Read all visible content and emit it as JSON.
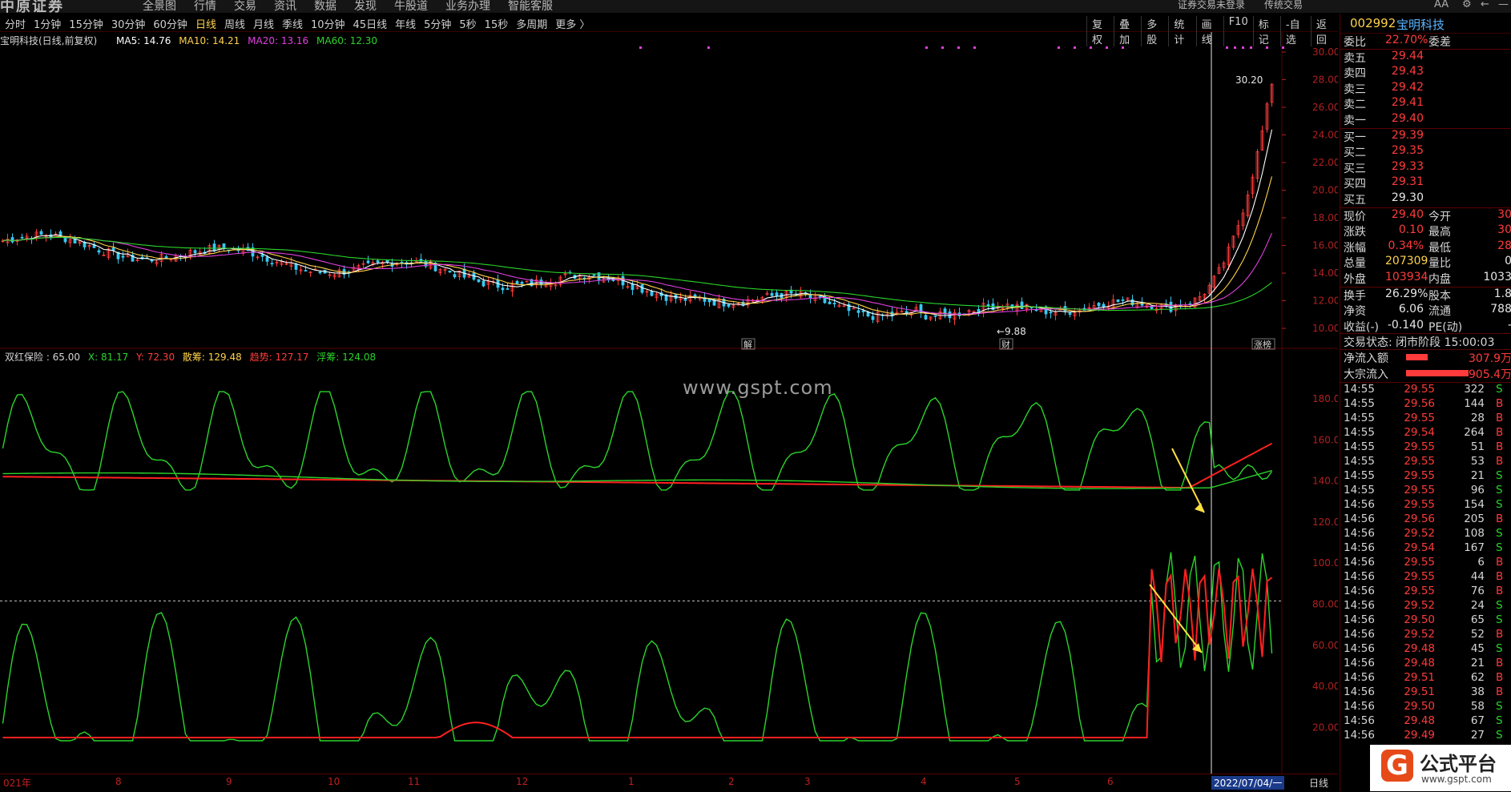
{
  "app": {
    "logo": "中原证券",
    "menu": [
      "全景图",
      "行情",
      "交易",
      "资讯",
      "数据",
      "发现",
      "牛股道",
      "业务办理",
      "智能客服"
    ],
    "right_menu": [
      "证券交易未登录",
      "传统交易"
    ],
    "font_btn": "AA"
  },
  "period_bar": {
    "items": [
      "分时",
      "1分钟",
      "15分钟",
      "30分钟",
      "60分钟",
      "日线",
      "周线",
      "月线",
      "季线",
      "10分钟",
      "45日线",
      "年线",
      "5分钟",
      "5秒",
      "15秒",
      "多周期",
      "更多 〉"
    ],
    "active": "日线",
    "tools": [
      "复权",
      "叠加",
      "多股",
      "统计",
      "画线",
      "F10",
      "标记",
      "-自选",
      "返回"
    ]
  },
  "chart_header": {
    "title": "宝明科技(日线,前复权)",
    "ma5": "MA5: 14.76",
    "ma10": "MA10: 14.21",
    "ma20": "MA20: 13.16",
    "ma60": "MA60: 12.30"
  },
  "price_axis": [
    "30.00",
    "28.00",
    "26.00",
    "24.00",
    "22.00",
    "20.00",
    "18.00",
    "16.00",
    "14.00",
    "12.00",
    "10.00"
  ],
  "price_annotations": {
    "high": "30.20",
    "low": "9.88",
    "mark1": "解",
    "mark2": "财",
    "mark3": "涨榜"
  },
  "indicator_header": {
    "name": "双红保险 : 65.00",
    "x": "X: 81.17",
    "y": "Y: 72.30",
    "sanchou": "散筹: 129.48",
    "qushi": "趋势: 127.17",
    "fuchou": "浮筹: 124.08"
  },
  "indicator_axis": [
    "180.00",
    "160.00",
    "140.00",
    "120.00",
    "100.00",
    "80.00",
    "60.00",
    "40.00",
    "20.00"
  ],
  "watermark_site": "www.gspt.com",
  "date_axis": {
    "labels": [
      "021年",
      "8",
      "9",
      "10",
      "11",
      "12",
      "1",
      "2",
      "3",
      "4",
      "5",
      "6"
    ],
    "cursor_date": "2022/07/04/一",
    "period": "日线"
  },
  "quote": {
    "code": "002992",
    "name": "宝明科技",
    "weibi_label": "委比",
    "weibi": "22.70%",
    "weicha_label": "委差",
    "asks": [
      {
        "label": "卖五",
        "price": "29.44"
      },
      {
        "label": "卖四",
        "price": "29.43"
      },
      {
        "label": "卖三",
        "price": "29.42"
      },
      {
        "label": "卖二",
        "price": "29.41"
      },
      {
        "label": "卖一",
        "price": "29.40"
      }
    ],
    "bids": [
      {
        "label": "买一",
        "price": "29.39"
      },
      {
        "label": "买二",
        "price": "29.35"
      },
      {
        "label": "买三",
        "price": "29.33"
      },
      {
        "label": "买四",
        "price": "29.31"
      },
      {
        "label": "买五",
        "price": "29.30"
      }
    ],
    "stats": [
      {
        "l": "现价",
        "v": "29.40",
        "c": "red",
        "l2": "今开",
        "v2": "30"
      },
      {
        "l": "涨跌",
        "v": "0.10",
        "c": "red",
        "l2": "最高",
        "v2": "30"
      },
      {
        "l": "涨幅",
        "v": "0.34%",
        "c": "red",
        "l2": "最低",
        "v2": "28"
      },
      {
        "l": "总量",
        "v": "207309",
        "c": "yel",
        "l2": "量比",
        "v2": "0"
      },
      {
        "l": "外盘",
        "v": "103934",
        "c": "red",
        "l2": "内盘",
        "v2": "1033"
      },
      {
        "l": "换手",
        "v": "26.29%",
        "c": "white",
        "l2": "股本",
        "v2": "1.8"
      },
      {
        "l": "净资",
        "v": "6.06",
        "c": "white",
        "l2": "流通",
        "v2": "788"
      },
      {
        "l": "收益(-)",
        "v": "-0.140",
        "c": "white",
        "l2": "PE(动)",
        "v2": "-"
      }
    ],
    "status": "交易状态: 闭市阶段 15:00:03",
    "flows": [
      {
        "label": "净流入额",
        "value": "307.9万",
        "bar": 0.18
      },
      {
        "label": "大宗流入",
        "value": "905.4万",
        "bar": 0.52
      }
    ],
    "ticks": [
      {
        "t": "14:55",
        "p": "29.55",
        "q": "322",
        "d": "S"
      },
      {
        "t": "14:55",
        "p": "29.56",
        "q": "144",
        "d": "B"
      },
      {
        "t": "14:55",
        "p": "29.55",
        "q": "28",
        "d": "B"
      },
      {
        "t": "14:55",
        "p": "29.54",
        "q": "264",
        "d": "B"
      },
      {
        "t": "14:55",
        "p": "29.55",
        "q": "51",
        "d": "B"
      },
      {
        "t": "14:55",
        "p": "29.55",
        "q": "53",
        "d": "B"
      },
      {
        "t": "14:55",
        "p": "29.55",
        "q": "21",
        "d": "S"
      },
      {
        "t": "14:55",
        "p": "29.55",
        "q": "96",
        "d": "S"
      },
      {
        "t": "14:56",
        "p": "29.55",
        "q": "154",
        "d": "S"
      },
      {
        "t": "14:56",
        "p": "29.56",
        "q": "205",
        "d": "B"
      },
      {
        "t": "14:56",
        "p": "29.52",
        "q": "108",
        "d": "S"
      },
      {
        "t": "14:56",
        "p": "29.54",
        "q": "167",
        "d": "S"
      },
      {
        "t": "14:56",
        "p": "29.55",
        "q": "6",
        "d": "B"
      },
      {
        "t": "14:56",
        "p": "29.55",
        "q": "44",
        "d": "B"
      },
      {
        "t": "14:56",
        "p": "29.55",
        "q": "76",
        "d": "B"
      },
      {
        "t": "14:56",
        "p": "29.52",
        "q": "24",
        "d": "S"
      },
      {
        "t": "14:56",
        "p": "29.50",
        "q": "65",
        "d": "S"
      },
      {
        "t": "14:56",
        "p": "29.52",
        "q": "52",
        "d": "B"
      },
      {
        "t": "14:56",
        "p": "29.48",
        "q": "45",
        "d": "S"
      },
      {
        "t": "14:56",
        "p": "29.48",
        "q": "21",
        "d": "B"
      },
      {
        "t": "14:56",
        "p": "29.51",
        "q": "62",
        "d": "B"
      },
      {
        "t": "14:56",
        "p": "29.51",
        "q": "38",
        "d": "B"
      },
      {
        "t": "14:56",
        "p": "29.50",
        "q": "58",
        "d": "S"
      },
      {
        "t": "14:56",
        "p": "29.48",
        "q": "67",
        "d": "S"
      },
      {
        "t": "14:56",
        "p": "29.49",
        "q": "27",
        "d": "S"
      }
    ]
  },
  "brand_watermark": {
    "glyph": "G",
    "title": "公式平台",
    "url": "www.gspt.com"
  },
  "colors": {
    "up": "#ff3b3b",
    "down": "#2bd42b",
    "ma5": "#ffffff",
    "ma10": "#ffd24a",
    "ma20": "#e040e0",
    "ma60": "#2bd42b",
    "grid": "#5a0000"
  }
}
